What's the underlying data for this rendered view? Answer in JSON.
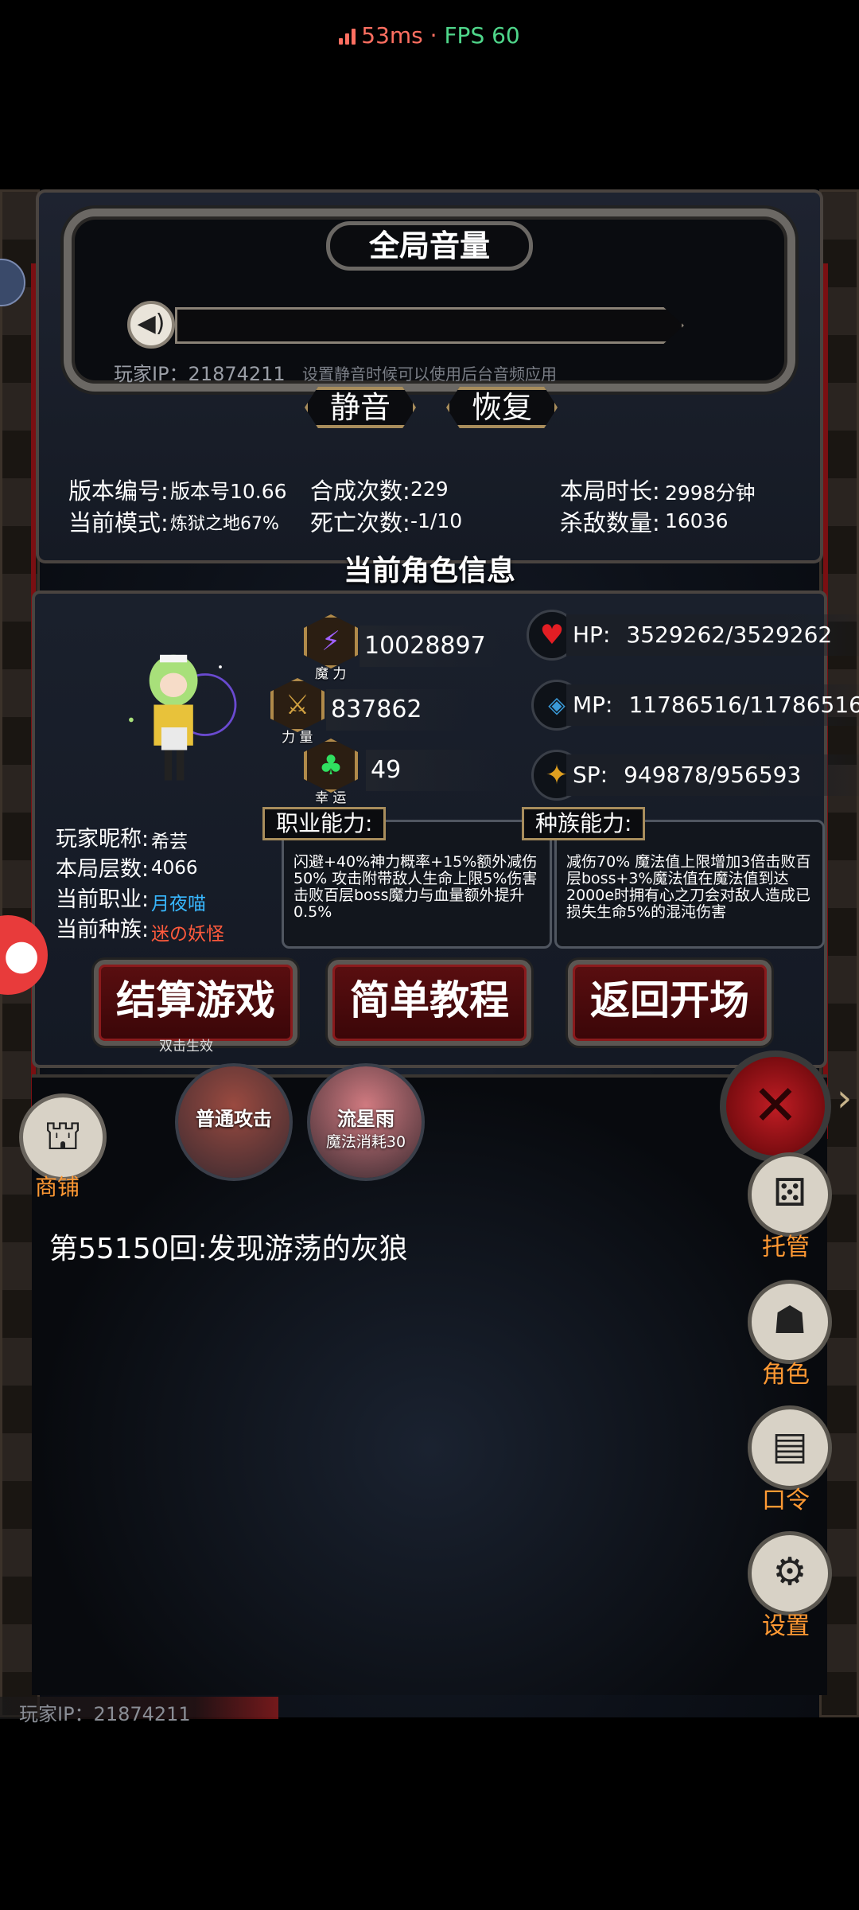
{
  "status": {
    "ping": "53ms",
    "sep": " · ",
    "fps": "FPS 60"
  },
  "volume": {
    "title": "全局音量",
    "player_ip": "玩家IP：21874211",
    "hint": "设置静音时候可以使用后台音频应用",
    "mute_label": "静音",
    "restore_label": "恢复"
  },
  "stats": {
    "version_label": "版本编号:",
    "version_value": "版本号10.66",
    "mode_label": "当前模式:",
    "mode_value": "炼狱之地67%",
    "craft_label": "合成次数:",
    "craft_value": "229",
    "death_label": "死亡次数:",
    "death_value": "-1/10",
    "duration_label": "本局时长:",
    "duration_value": "2998分钟",
    "kills_label": "杀敌数量:",
    "kills_value": "16036"
  },
  "character": {
    "section_title": "当前角色信息",
    "nickname_label": "玩家昵称:",
    "nickname": "希芸",
    "floors_label": "本局层数:",
    "floors": "4066",
    "job_label": "当前职业:",
    "job": "月夜喵",
    "race_label": "当前种族:",
    "race": "迷の妖怪",
    "magic_caption": "魔 力",
    "magic": "10028897",
    "strength_caption": "力 量",
    "strength": "837862",
    "luck_caption": "幸 运",
    "luck": "49",
    "hp_label": "HP:",
    "hp": "3529262/3529262",
    "mp_label": "MP:",
    "mp": "11786516/11786516",
    "sp_label": "SP:",
    "sp": "949878/956593",
    "job_ability_label": "职业能力:",
    "job_ability": "闪避+40%神力概率+15%额外减伤50% 攻击附带敌人生命上限5%伤害击败百层boss魔力与血量额外提升0.5%",
    "race_ability_label": "种族能力:",
    "race_ability": "减伤70% 魔法值上限增加3倍击败百层boss+3%魔法值在魔法值到达2000e时拥有心之刀会对敌人造成已损失生命5%的混沌伤害"
  },
  "actions": {
    "settle": "结算游戏",
    "settle_sub": "双击生效",
    "tutorial": "简单教程",
    "back": "返回开场"
  },
  "skills": [
    {
      "name": "普通攻击",
      "cost": ""
    },
    {
      "name": "流星雨",
      "cost": "魔法消耗30"
    }
  ],
  "side": {
    "shop": "商铺",
    "auto": "托管",
    "role": "角色",
    "code": "口令",
    "settings": "设置"
  },
  "log": {
    "line": "第55150回:发现游荡的灰狼"
  },
  "footer": {
    "player_ip": "玩家IP：21874211"
  },
  "colors": {
    "accent_orange": "#ff9933",
    "job_blue": "#38b8ff",
    "race_red": "#ff5a3c",
    "hp_red": "#e31e24"
  }
}
